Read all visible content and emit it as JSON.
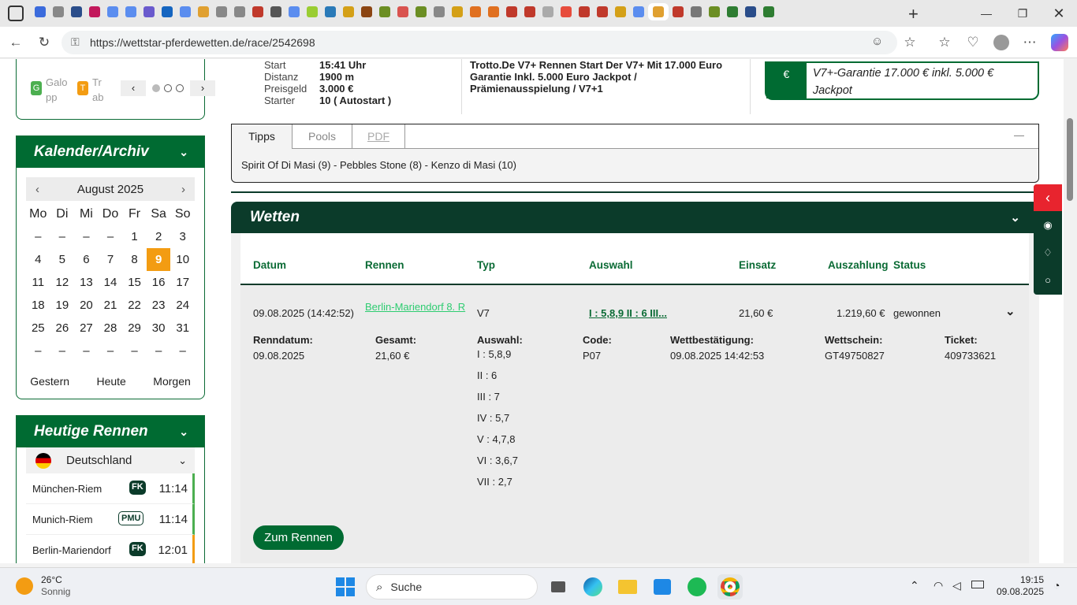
{
  "browser": {
    "url": "https://wettstar-pferdewetten.de/race/2542698",
    "tabs_colors": [
      "#3b6bdc",
      "#888",
      "#2a4d8a",
      "#c2185b",
      "#5b8def",
      "#5b8def",
      "#6a5acd",
      "#1565c0",
      "#5b8def",
      "#e0a030",
      "#888",
      "#888",
      "#c0392b",
      "#555",
      "#5b8def",
      "#9acd32",
      "#2a7ab8",
      "#d4a017",
      "#8b4513",
      "#6b8e23",
      "#d9534f",
      "#6b8e23",
      "#888",
      "#d4a017",
      "#e07020",
      "#e07020",
      "#c0392b",
      "#c0392b",
      "#aaa",
      "#e74c3c",
      "#c0392b",
      "#c0392b",
      "#d4a017",
      "#5b8def",
      "#e0a030",
      "#c0392b",
      "#777",
      "#6b8e23",
      "#2e7d32",
      "#2a4d8a",
      "#2e7d32"
    ]
  },
  "sidebar": {
    "type_galopp_letter": "G",
    "type_galopp": "Galopp",
    "type_trab_letter": "T",
    "type_trab": "Trab",
    "prev": "‹",
    "next": "›",
    "calendar_title": "Kalender/Archiv",
    "month": "August 2025",
    "weekdays": [
      "Mo",
      "Di",
      "Mi",
      "Do",
      "Fr",
      "Sa",
      "So"
    ],
    "days": [
      "–",
      "–",
      "–",
      "–",
      "1",
      "2",
      "3",
      "4",
      "5",
      "6",
      "7",
      "8",
      "9",
      "10",
      "11",
      "12",
      "13",
      "14",
      "15",
      "16",
      "17",
      "18",
      "19",
      "20",
      "21",
      "22",
      "23",
      "24",
      "25",
      "26",
      "27",
      "28",
      "29",
      "30",
      "31",
      "–",
      "–",
      "–",
      "–",
      "–",
      "–",
      "–"
    ],
    "today": "9",
    "gestern": "Gestern",
    "heute": "Heute",
    "morgen": "Morgen",
    "races_title": "Heutige Rennen",
    "country": "Deutschland",
    "races": [
      {
        "name": "München-Riem",
        "badge": "FK",
        "time": "11:14",
        "color": "#4caf50"
      },
      {
        "name": "Munich-Riem",
        "badge": "PMU",
        "time": "11:14",
        "color": "#4caf50"
      },
      {
        "name": "Berlin-Mariendorf",
        "badge": "FK",
        "time": "12:01",
        "color": "#f39c12"
      }
    ]
  },
  "race_info": {
    "start_label": "Start",
    "start": "15:41 Uhr",
    "distanz_label": "Distanz",
    "distanz": "1900 m",
    "preisgeld_label": "Preisgeld",
    "preisgeld": "3.000 €",
    "starter_label": "Starter",
    "starter": "10 ( Autostart )",
    "description": "Trotto.De V7+ Rennen Start Der V7+ Mit 17.000 Euro Garantie Inkl. 5.000 Euro Jackpot / Prämienausspielung / V7+1",
    "garantie": "V7+-Garantie 17.000 € inkl. 5.000 € Jackpot"
  },
  "tips": {
    "tabs": [
      "Tipps",
      "Pools",
      "PDF"
    ],
    "text": "Spirit Of Di Masi (9) - Pebbles Stone (8) - Kenzo di Masi (10)",
    "collapse": "—"
  },
  "wetten": {
    "title": "Wetten",
    "cols": [
      "Datum",
      "Rennen",
      "Typ",
      "Auswahl",
      "Einsatz",
      "Auszahlung",
      "Status"
    ],
    "row": {
      "datum": "09.08.2025 (14:42:52)",
      "rennen": "Berlin-Mariendorf 8. R",
      "typ": "V7",
      "auswahl": "I : 5,8,9 II : 6 III...",
      "einsatz": "21,60 €",
      "auszahlung": "1.219,60 €",
      "status": "gewonnen"
    },
    "detail": {
      "renndatum_label": "Renndatum:",
      "renndatum": "09.08.2025",
      "gesamt_label": "Gesamt:",
      "gesamt": "21,60 €",
      "auswahl_label": "Auswahl:",
      "auswahl": [
        "I : 5,8,9",
        "II : 6",
        "III : 7",
        "IV : 5,7",
        "V : 4,7,8",
        "VI : 3,6,7",
        "VII : 2,7"
      ],
      "code_label": "Code:",
      "code": "P07",
      "bestaetigung_label": "Wettbestätigung:",
      "bestaetigung": "09.08.2025 14:42:53",
      "schein_label": "Wettschein:",
      "schein": "GT49750827",
      "ticket_label": "Ticket:",
      "ticket": "409733621"
    },
    "zum_rennen": "Zum Rennen"
  },
  "taskbar": {
    "temp": "26°C",
    "weather": "Sonnig",
    "search": "Suche",
    "time": "19:15",
    "date": "09.08.2025"
  }
}
